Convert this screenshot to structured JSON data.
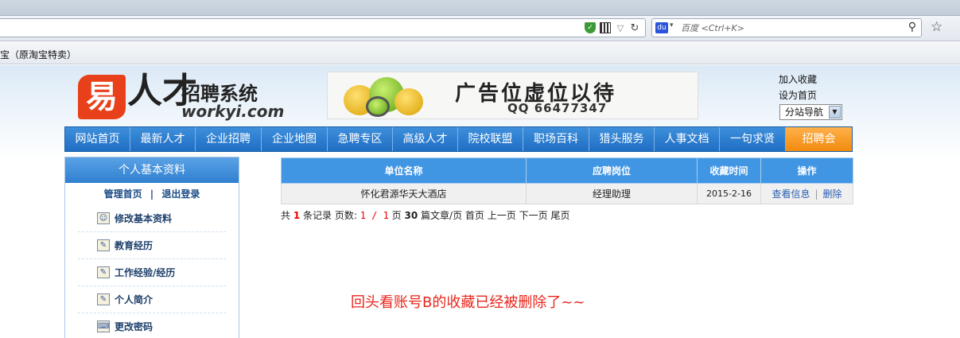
{
  "browser": {
    "search_placeholder": "百度 <Ctrl+K>",
    "bookmark": "宝（原淘宝特卖）"
  },
  "logo": {
    "mark": "易",
    "ren": "人才",
    "cn": "招聘系统",
    "url": "workyi.com"
  },
  "ad": {
    "title": "广告位虚位以待",
    "qq": "QQ 66477347"
  },
  "toplinks": {
    "fav": "加入收藏",
    "home": "设为首页",
    "subsite": "分站导航"
  },
  "nav": [
    "网站首页",
    "最新人才",
    "企业招聘",
    "企业地图",
    "急聘专区",
    "高级人才",
    "院校联盟",
    "职场百科",
    "猎头服务",
    "人事文档",
    "一句求贤",
    "招聘会"
  ],
  "sidebar": {
    "title": "个人基本资料",
    "manage": "管理首页",
    "sep": "|",
    "logout": "退出登录",
    "items": [
      "修改基本资料",
      "教育经历",
      "工作经验/经历",
      "个人简介",
      "更改密码"
    ]
  },
  "table": {
    "headers": [
      "单位名称",
      "应聘岗位",
      "收藏时间",
      "操作"
    ],
    "rows": [
      {
        "company": "怀化君源华天大酒店",
        "position": "经理助理",
        "date": "2015-2-16",
        "view": "查看信息",
        "delete": "删除"
      }
    ]
  },
  "pager": {
    "t1": "共",
    "count": "1",
    "t2": "条记录 页数:",
    "page": "1 / 1",
    "t3": "页",
    "per": "30",
    "t4": "篇文章/页",
    "first": "首页",
    "prev": "上一页",
    "next": "下一页",
    "last": "尾页"
  },
  "annotation": "回头看账号B的收藏已经被删除了~~"
}
